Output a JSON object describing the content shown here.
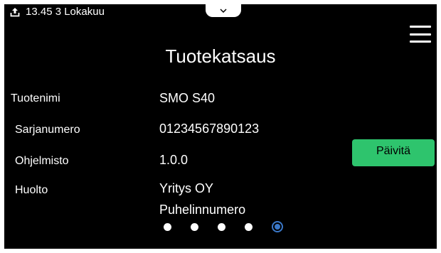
{
  "status_bar": {
    "time_date": "13.45 3 Lokakuu",
    "upload_icon": "upload-icon"
  },
  "header": {
    "title": "Tuotekatsaus",
    "menu_icon": "hamburger-menu-icon",
    "pull_tab_icon": "chevron-down-icon"
  },
  "info": {
    "product_name_label": "Tuotenimi",
    "product_name_value": "SMO S40",
    "serial_label": "Sarjanumero",
    "serial_value": "01234567890123",
    "software_label": "Ohjelmisto",
    "software_value": "1.0.0",
    "service_label": "Huolto",
    "service_company": "Yritys OY",
    "service_phone": "Puhelinnumero"
  },
  "actions": {
    "update_label": "Päivitä"
  },
  "pager": {
    "total_pages": 5,
    "current_page": 5
  },
  "colors": {
    "background": "#000000",
    "accent_button": "#2ec46d",
    "pager_active": "#3a78c9"
  }
}
